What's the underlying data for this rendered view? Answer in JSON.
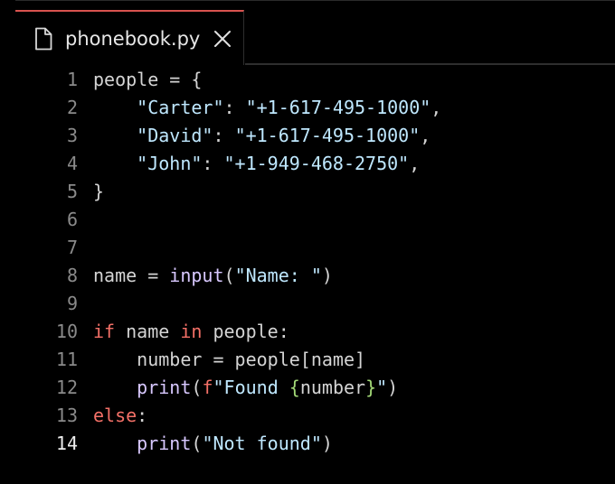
{
  "tab": {
    "title": "phonebook.py",
    "icon": "file-icon",
    "close_icon": "close-icon",
    "accent_color": "#d9534f",
    "active": true
  },
  "editor": {
    "active_line": 14,
    "lines": [
      {
        "number": "1",
        "tokens": [
          {
            "text": "people = {",
            "kind": "plain"
          }
        ]
      },
      {
        "number": "2",
        "tokens": [
          {
            "text": "    ",
            "kind": "plain"
          },
          {
            "text": "\"Carter\"",
            "kind": "string"
          },
          {
            "text": ": ",
            "kind": "plain"
          },
          {
            "text": "\"+1-617-495-1000\"",
            "kind": "string"
          },
          {
            "text": ",",
            "kind": "plain"
          }
        ]
      },
      {
        "number": "3",
        "tokens": [
          {
            "text": "    ",
            "kind": "plain"
          },
          {
            "text": "\"David\"",
            "kind": "string"
          },
          {
            "text": ": ",
            "kind": "plain"
          },
          {
            "text": "\"+1-617-495-1000\"",
            "kind": "string"
          },
          {
            "text": ",",
            "kind": "plain"
          }
        ]
      },
      {
        "number": "4",
        "tokens": [
          {
            "text": "    ",
            "kind": "plain"
          },
          {
            "text": "\"John\"",
            "kind": "string"
          },
          {
            "text": ": ",
            "kind": "plain"
          },
          {
            "text": "\"+1-949-468-2750\"",
            "kind": "string"
          },
          {
            "text": ",",
            "kind": "plain"
          }
        ]
      },
      {
        "number": "5",
        "tokens": [
          {
            "text": "}",
            "kind": "plain"
          }
        ]
      },
      {
        "number": "6",
        "tokens": []
      },
      {
        "number": "7",
        "tokens": []
      },
      {
        "number": "8",
        "tokens": [
          {
            "text": "name = ",
            "kind": "plain"
          },
          {
            "text": "input",
            "kind": "func"
          },
          {
            "text": "(",
            "kind": "plain"
          },
          {
            "text": "\"Name: \"",
            "kind": "string"
          },
          {
            "text": ")",
            "kind": "plain"
          }
        ]
      },
      {
        "number": "9",
        "tokens": []
      },
      {
        "number": "10",
        "tokens": [
          {
            "text": "if",
            "kind": "keyword"
          },
          {
            "text": " name ",
            "kind": "plain"
          },
          {
            "text": "in",
            "kind": "keyword"
          },
          {
            "text": " people:",
            "kind": "plain"
          }
        ]
      },
      {
        "number": "11",
        "tokens": [
          {
            "text": "    number = people[name]",
            "kind": "plain"
          }
        ]
      },
      {
        "number": "12",
        "tokens": [
          {
            "text": "    ",
            "kind": "plain"
          },
          {
            "text": "print",
            "kind": "func"
          },
          {
            "text": "(",
            "kind": "plain"
          },
          {
            "text": "f",
            "kind": "fprefix"
          },
          {
            "text": "\"Found ",
            "kind": "string"
          },
          {
            "text": "{",
            "kind": "brace"
          },
          {
            "text": "number",
            "kind": "plain"
          },
          {
            "text": "}",
            "kind": "brace"
          },
          {
            "text": "\"",
            "kind": "string"
          },
          {
            "text": ")",
            "kind": "plain"
          }
        ]
      },
      {
        "number": "13",
        "tokens": [
          {
            "text": "else",
            "kind": "keyword"
          },
          {
            "text": ":",
            "kind": "plain"
          }
        ]
      },
      {
        "number": "14",
        "tokens": [
          {
            "text": "    ",
            "kind": "plain"
          },
          {
            "text": "print",
            "kind": "func"
          },
          {
            "text": "(",
            "kind": "plain"
          },
          {
            "text": "\"Not found\"",
            "kind": "string"
          },
          {
            "text": ")",
            "kind": "plain"
          }
        ]
      }
    ]
  }
}
